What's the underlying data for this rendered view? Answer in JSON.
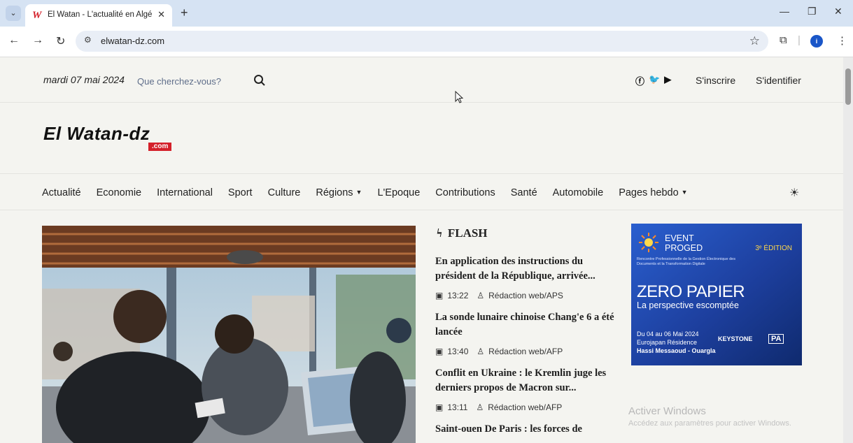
{
  "browser": {
    "tab_title": "El Watan - L'actualité en Algérie",
    "tab_favicon": "W",
    "tab_close": "✕",
    "new_tab": "+",
    "url": "elwatan-dz.com",
    "minimize": "—",
    "restore": "❐",
    "close": "✕",
    "profile_initial": "i"
  },
  "topbar": {
    "date": "mardi 07 mai 2024",
    "search_placeholder": "Que cherchez-vous?",
    "signup": "S'inscrire",
    "signin": "S'identifier"
  },
  "logo": {
    "name": "El Watan-dz",
    "tld": ".com"
  },
  "nav": {
    "items": [
      {
        "label": "Actualité",
        "dropdown": false
      },
      {
        "label": "Economie",
        "dropdown": false
      },
      {
        "label": "International",
        "dropdown": false
      },
      {
        "label": "Sport",
        "dropdown": false
      },
      {
        "label": "Culture",
        "dropdown": false
      },
      {
        "label": "Régions",
        "dropdown": true
      },
      {
        "label": "L'Epoque",
        "dropdown": false
      },
      {
        "label": "Contributions",
        "dropdown": false
      },
      {
        "label": "Santé",
        "dropdown": false
      },
      {
        "label": "Automobile",
        "dropdown": false
      },
      {
        "label": "Pages hebdo",
        "dropdown": true
      }
    ]
  },
  "flash": {
    "heading": "FLASH",
    "items": [
      {
        "title": "En application des instructions du président de la République, arrivée...",
        "time": "13:22",
        "author": "Rédaction web/APS"
      },
      {
        "title": "La sonde lunaire chinoise Chang'e 6 a été lancée",
        "time": "13:40",
        "author": "Rédaction web/AFP"
      },
      {
        "title": "Conflit en Ukraine : le Kremlin juge les derniers propos de Macron sur...",
        "time": "13:11",
        "author": "Rédaction web/AFP"
      },
      {
        "title": "Saint-ouen De Paris : les forces de",
        "time": "",
        "author": ""
      }
    ]
  },
  "ad": {
    "event_line1": "EVENT",
    "event_line2": "PROGED",
    "edition": "3ᵉ ÉDITION",
    "small_text": "Rencontre Professionnelle de la Gestion Électronique des Documents et la Transformation Digitale",
    "headline": "ZERO PAPIER",
    "subhead": "La perspective escomptée",
    "date_line1": "Du 04 au 06 Mai 2024",
    "date_line2": "Eurojapan Résidence",
    "date_line3": "Hassi Messaoud - Ouargla",
    "sponsor1": "KEYSTONE",
    "sponsor2": "PA"
  },
  "watermark": {
    "title": "Activer Windows",
    "subtitle": "Accédez aux paramètres pour activer Windows."
  }
}
